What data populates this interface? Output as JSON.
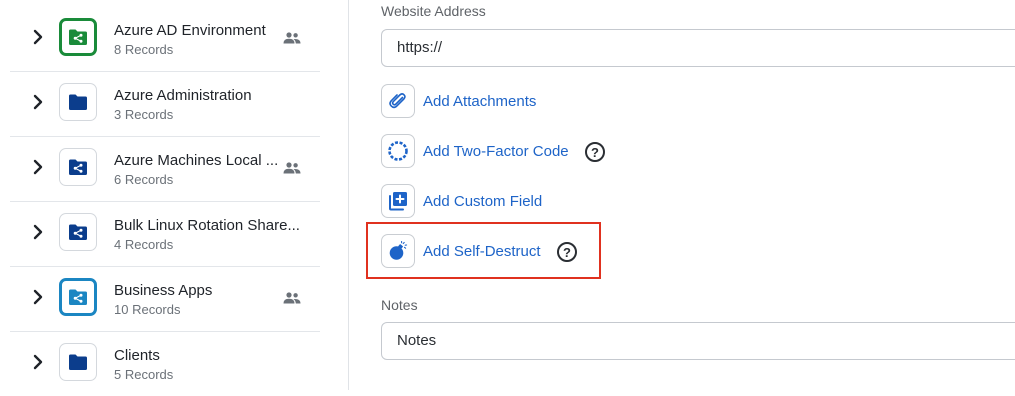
{
  "folders": [
    {
      "name": "Azure AD Environment",
      "records": "8 Records",
      "icon": "shared-folder-icon",
      "icon_style": "green-outline",
      "shared": true
    },
    {
      "name": "Azure Administration",
      "records": "3 Records",
      "icon": "folder-icon",
      "icon_style": "plain",
      "shared": false
    },
    {
      "name": "Azure Machines Local ...",
      "records": "6 Records",
      "icon": "shared-folder-icon",
      "icon_style": "plain",
      "shared": true
    },
    {
      "name": "Bulk Linux Rotation Share...",
      "records": "4 Records",
      "icon": "shared-folder-icon",
      "icon_style": "plain",
      "shared": false
    },
    {
      "name": "Business Apps",
      "records": "10 Records",
      "icon": "shared-folder-icon",
      "icon_style": "blue-outline",
      "shared": true
    },
    {
      "name": "Clients",
      "records": "5 Records",
      "icon": "folder-icon",
      "icon_style": "plain",
      "shared": false
    }
  ],
  "form": {
    "website_label": "Website Address",
    "website_value": "https://",
    "actions": [
      {
        "label": "Add Attachments",
        "icon": "paperclip-icon",
        "help": false
      },
      {
        "label": "Add Two-Factor Code",
        "icon": "totp-ring-icon",
        "help": true
      },
      {
        "label": "Add Custom Field",
        "icon": "add-field-icon",
        "help": false
      },
      {
        "label": "Add Self-Destruct",
        "icon": "bomb-icon",
        "help": true,
        "highlighted": true
      }
    ],
    "help_glyph": "?",
    "notes_label": "Notes",
    "notes_placeholder": "Notes"
  },
  "colors": {
    "link": "#1e64c8",
    "folder": "#0b3d8c",
    "green_outline": "#1a8b3a",
    "blue_outline": "#1b86c2",
    "highlight": "#e0311f"
  }
}
